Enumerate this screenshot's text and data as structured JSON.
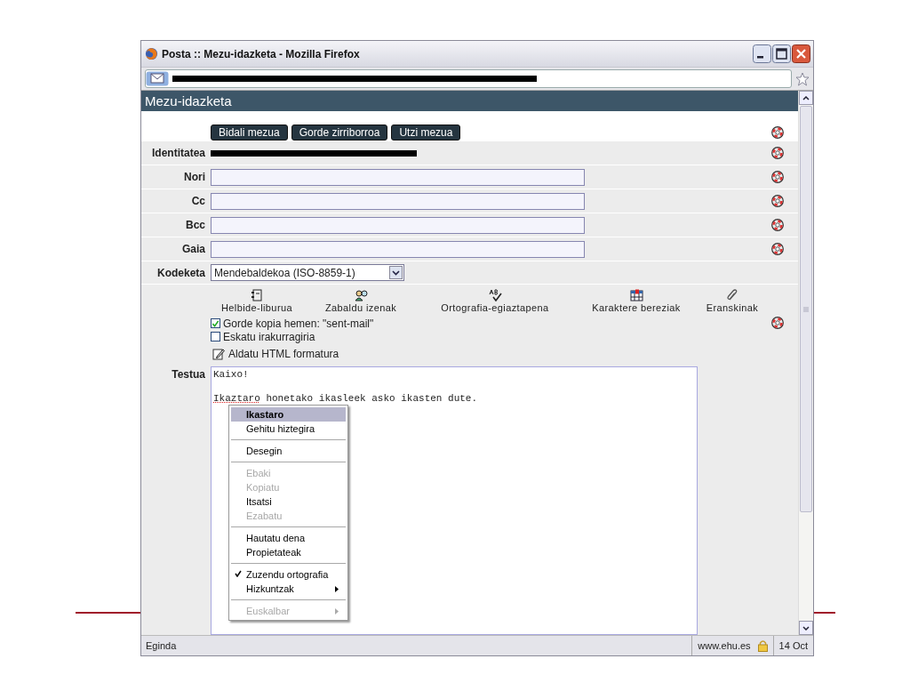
{
  "window": {
    "title": "Posta :: Mezu-idazketa - Mozilla Firefox"
  },
  "page": {
    "heading": "Mezu-idazketa"
  },
  "buttons": [
    "Bidali mezua",
    "Gorde zirriborroa",
    "Utzi mezua"
  ],
  "fields": [
    {
      "label": "Identitatea",
      "kind": "redacted"
    },
    {
      "label": "Nori",
      "kind": "text"
    },
    {
      "label": "Cc",
      "kind": "text"
    },
    {
      "label": "Bcc",
      "kind": "text"
    },
    {
      "label": "Gaia",
      "kind": "text"
    },
    {
      "label": "Kodeketa",
      "kind": "select",
      "value": "Mendebaldekoa (ISO-8859-1)"
    }
  ],
  "tools": [
    {
      "label": "Helbide-liburua",
      "kind": "address-book"
    },
    {
      "label": "Zabaldu izenak",
      "kind": "expand-names"
    },
    {
      "label": "Ortografia-egiaztapena",
      "kind": "spellcheck"
    },
    {
      "label": "Karaktere bereziak",
      "kind": "special-chars"
    },
    {
      "label": "Eranskinak",
      "kind": "attachments"
    }
  ],
  "options": [
    {
      "label": "Gorde kopia hemen: \"sent-mail\"",
      "checked": true
    },
    {
      "label": "Eskatu irakurragiria",
      "checked": false
    }
  ],
  "html_link": "Aldatu HTML formatura",
  "body": {
    "label": "Testua",
    "paragraphs": [
      {
        "text": "Kaixo!",
        "misspelled": false
      },
      {
        "text": "Ikaztaro honetako ikasleek asko ikasten dute.",
        "misspelled": true
      }
    ]
  },
  "context_menu": [
    {
      "kind": "suggestion",
      "label": "Ikastaro",
      "selected": true,
      "disabled": false,
      "checked": false,
      "submenu": false
    },
    {
      "kind": "item",
      "label": "Gehitu hiztegira",
      "selected": false,
      "disabled": false,
      "checked": false,
      "submenu": false
    },
    {
      "kind": "separator"
    },
    {
      "kind": "item",
      "label": "Desegin",
      "selected": false,
      "disabled": false,
      "checked": false,
      "submenu": false
    },
    {
      "kind": "separator"
    },
    {
      "kind": "item",
      "label": "Ebaki",
      "selected": false,
      "disabled": true,
      "checked": false,
      "submenu": false
    },
    {
      "kind": "item",
      "label": "Kopiatu",
      "selected": false,
      "disabled": true,
      "checked": false,
      "submenu": false
    },
    {
      "kind": "item",
      "label": "Itsatsi",
      "selected": false,
      "disabled": false,
      "checked": false,
      "submenu": false
    },
    {
      "kind": "item",
      "label": "Ezabatu",
      "selected": false,
      "disabled": true,
      "checked": false,
      "submenu": false
    },
    {
      "kind": "separator"
    },
    {
      "kind": "item",
      "label": "Hautatu dena",
      "selected": false,
      "disabled": false,
      "checked": false,
      "submenu": false
    },
    {
      "kind": "item",
      "label": "Propietateak",
      "selected": false,
      "disabled": false,
      "checked": false,
      "submenu": false
    },
    {
      "kind": "separator"
    },
    {
      "kind": "item",
      "label": "Zuzendu ortografia",
      "selected": false,
      "disabled": false,
      "checked": true,
      "submenu": false
    },
    {
      "kind": "item",
      "label": "Hizkuntzak",
      "selected": false,
      "disabled": false,
      "checked": false,
      "submenu": true
    },
    {
      "kind": "separator"
    },
    {
      "kind": "item",
      "label": "Euskalbar",
      "selected": false,
      "disabled": true,
      "checked": false,
      "submenu": true
    }
  ],
  "status_bar": {
    "text": "Eginda",
    "site": "www.ehu.es",
    "date": "14 Oct"
  }
}
